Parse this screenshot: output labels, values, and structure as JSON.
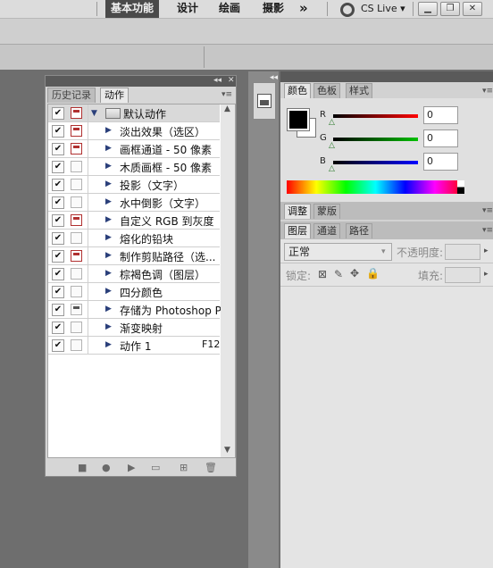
{
  "topbar": {
    "workspace_active": "基本功能",
    "workspace_design": "设计",
    "workspace_painting": "绘画",
    "workspace_photography": "摄影",
    "more": "»",
    "cs_live": "CS Live"
  },
  "actions_panel": {
    "tabs": [
      "历史记录",
      "动作"
    ],
    "set_name": "默认动作",
    "items": [
      {
        "label": "淡出效果（选区）",
        "checked": "✔",
        "dialog": "on"
      },
      {
        "label": "画框通道 - 50 像素",
        "checked": "✔",
        "dialog": "on"
      },
      {
        "label": "木质画框 - 50 像素",
        "checked": "✔",
        "dialog": "off"
      },
      {
        "label": "投影（文字）",
        "checked": "✔",
        "dialog": "off"
      },
      {
        "label": "水中倒影（文字）",
        "checked": "✔",
        "dialog": "off"
      },
      {
        "label": "自定义 RGB 到灰度",
        "checked": "✔",
        "dialog": "on"
      },
      {
        "label": "熔化的铅块",
        "checked": "✔",
        "dialog": "off"
      },
      {
        "label": "制作剪贴路径（选...",
        "checked": "✔",
        "dialog": "on"
      },
      {
        "label": "棕褐色调（图层）",
        "checked": "✔",
        "dialog": "off"
      },
      {
        "label": "四分颜色",
        "checked": "✔",
        "dialog": "off"
      },
      {
        "label": "存储为 Photoshop P...",
        "checked": "✔",
        "dialog": "gray"
      },
      {
        "label": "渐变映射",
        "checked": "✔",
        "dialog": "off"
      },
      {
        "label": "动作 1",
        "checked": "✔",
        "dialog": "off",
        "shortcut": "F12"
      }
    ],
    "set_checked": "✔"
  },
  "color_panel": {
    "tabs": [
      "颜色",
      "色板",
      "样式"
    ],
    "r_label": "R",
    "g_label": "G",
    "b_label": "B",
    "r_value": "0",
    "g_value": "0",
    "b_value": "0"
  },
  "adjust_panel": {
    "tabs": [
      "调整",
      "蒙版"
    ]
  },
  "layers_panel": {
    "tabs": [
      "图层",
      "通道",
      "路径"
    ],
    "blend_mode": "正常",
    "opacity_label": "不透明度:",
    "lock_label": "锁定:",
    "fill_label": "填充:"
  },
  "colors": {
    "panel_bg": "#d6d6d6",
    "dialog_red": "#b03030",
    "triangle_blue": "#2a3f7a"
  }
}
